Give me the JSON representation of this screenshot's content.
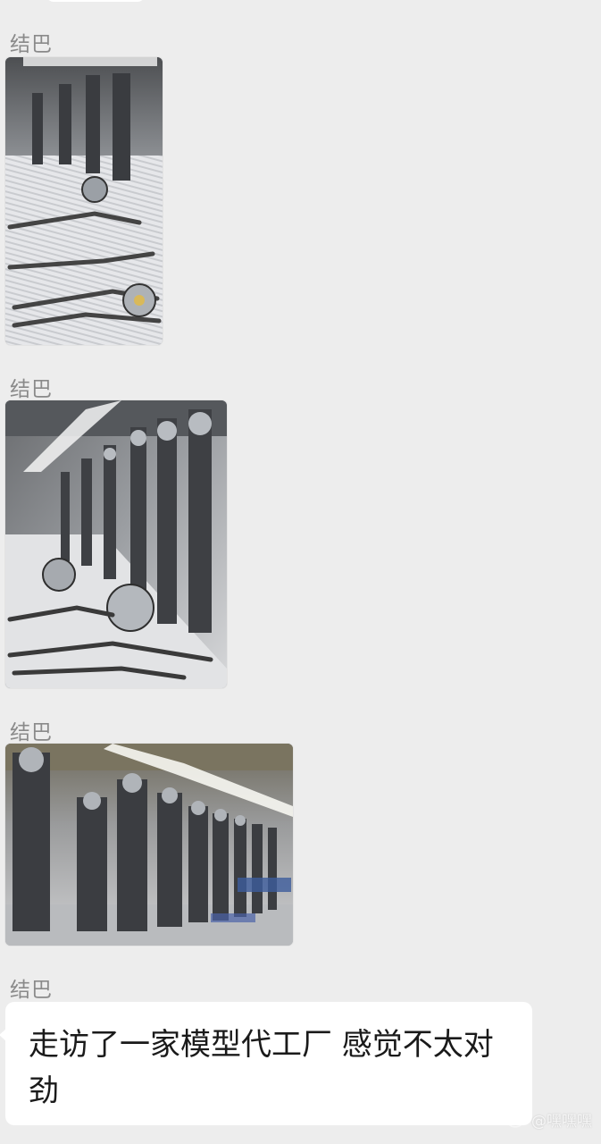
{
  "messages": [
    {
      "sender": "结巴",
      "type": "image",
      "image_icon": "photo-robot-arms-workbench"
    },
    {
      "sender": "结巴",
      "type": "image",
      "image_icon": "photo-robot-skeletons-row"
    },
    {
      "sender": "结巴",
      "type": "image",
      "image_icon": "photo-robot-assembly-line"
    },
    {
      "sender": "结巴",
      "type": "text",
      "text": "走访了一家模型代工厂 感觉不太对劲"
    }
  ],
  "watermark": {
    "text": "@嘿嘿嘿",
    "icon": "weibo-logo-icon"
  },
  "colors": {
    "background": "#ededed",
    "bubble": "#ffffff",
    "sender_name": "#8a8a8a"
  }
}
